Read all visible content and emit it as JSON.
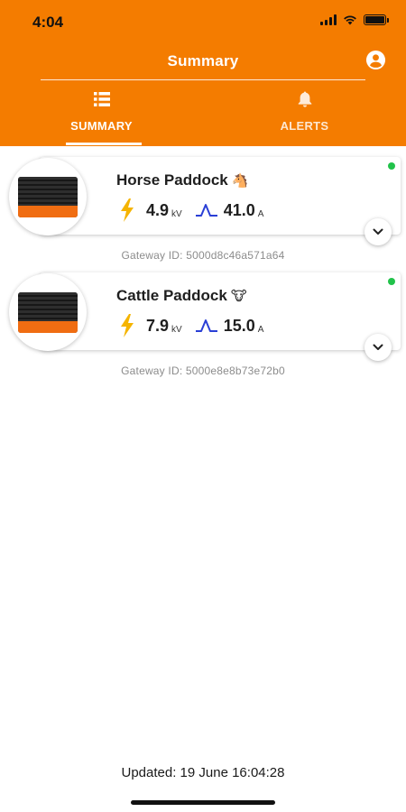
{
  "status_bar": {
    "time": "4:04",
    "icons": [
      "signal-icon",
      "wifi-icon",
      "battery-icon"
    ]
  },
  "header": {
    "title": "Summary",
    "profile_icon": "account-circle-icon",
    "background_color": "#f47c00"
  },
  "tabs": [
    {
      "label": "SUMMARY",
      "icon": "list-icon",
      "active": true
    },
    {
      "label": "ALERTS",
      "icon": "bell-icon",
      "active": false
    }
  ],
  "devices": [
    {
      "name": "Horse Paddock",
      "emoji": "🐴",
      "voltage": "4.9",
      "voltage_unit": "kV",
      "current": "41.0",
      "current_unit": "A",
      "gateway": "Gateway ID: 5000d8c46a571a64",
      "online": true
    },
    {
      "name": "Cattle Paddock",
      "emoji": "🐮",
      "voltage": "7.9",
      "voltage_unit": "kV",
      "current": "15.0",
      "current_unit": "A",
      "gateway": "Gateway ID: 5000e8e8b73e72b0",
      "online": true
    }
  ],
  "colors": {
    "accent": "#f47c00",
    "bolt": "#f5b400",
    "pulse": "#2a3fd6",
    "online": "#21c24a"
  },
  "footer": {
    "updated": "Updated: 19 June 16:04:28"
  }
}
